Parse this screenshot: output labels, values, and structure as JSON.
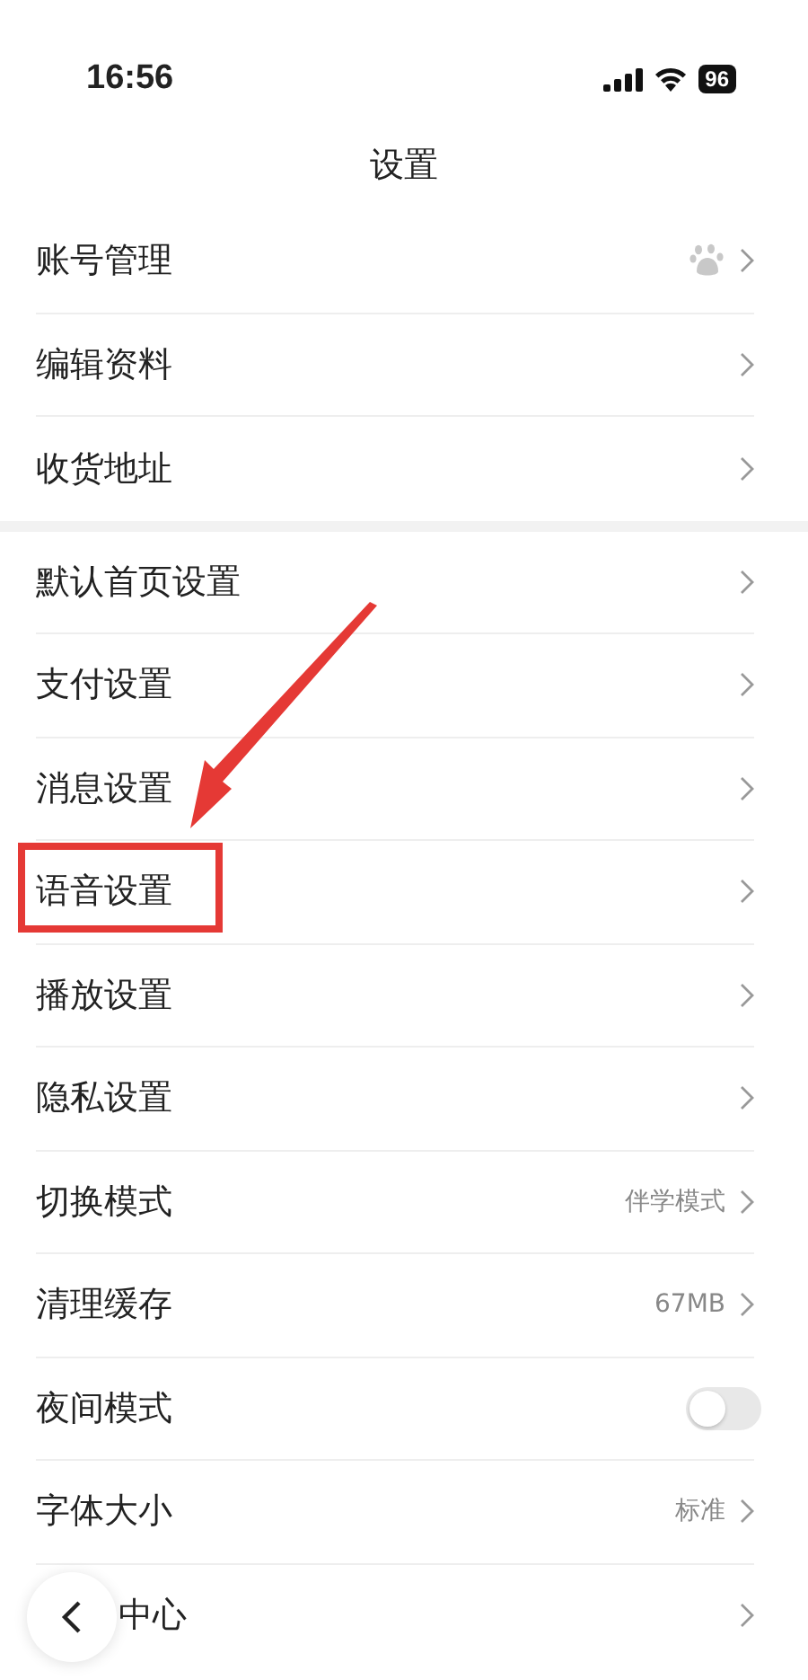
{
  "status_bar": {
    "time": "16:56",
    "battery": "96"
  },
  "title": "设置",
  "groups": [
    {
      "rows": [
        {
          "label": "账号管理",
          "kind": "paw"
        },
        {
          "label": "编辑资料",
          "kind": "chevron"
        },
        {
          "label": "收货地址",
          "kind": "chevron"
        }
      ]
    },
    {
      "rows": [
        {
          "label": "默认首页设置",
          "kind": "chevron"
        },
        {
          "label": "支付设置",
          "kind": "chevron"
        },
        {
          "label": "消息设置",
          "kind": "chevron"
        },
        {
          "label": "语音设置",
          "kind": "chevron",
          "highlighted": true
        },
        {
          "label": "播放设置",
          "kind": "chevron"
        },
        {
          "label": "隐私设置",
          "kind": "chevron"
        },
        {
          "label": "切换模式",
          "kind": "chevron",
          "value": "伴学模式"
        },
        {
          "label": "清理缓存",
          "kind": "chevron",
          "value": "67MB"
        },
        {
          "label": "夜间模式",
          "kind": "toggle",
          "on": false
        },
        {
          "label": "字体大小",
          "kind": "chevron",
          "value": "标准"
        },
        {
          "label": "中心",
          "kind": "chevron",
          "covered": true
        }
      ]
    }
  ]
}
